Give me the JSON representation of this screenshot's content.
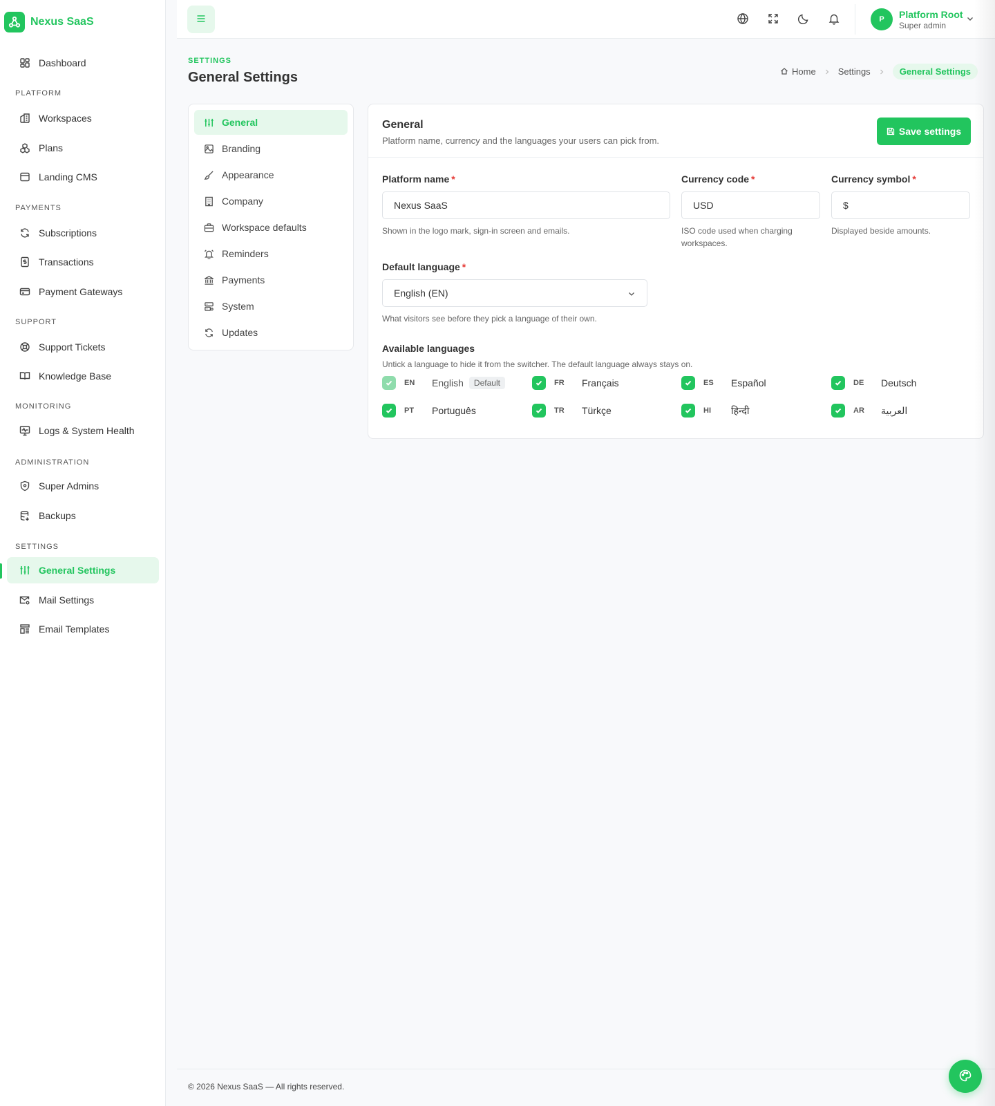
{
  "brand": {
    "name": "Nexus SaaS"
  },
  "sidebar": {
    "dashboard": "Dashboard",
    "sections": {
      "platform": "PLATFORM",
      "payments": "PAYMENTS",
      "support": "SUPPORT",
      "monitoring": "MONITORING",
      "administration": "ADMINISTRATION",
      "settings": "SETTINGS"
    },
    "items": {
      "workspaces": "Workspaces",
      "plans": "Plans",
      "landing_cms": "Landing CMS",
      "subscriptions": "Subscriptions",
      "transactions": "Transactions",
      "payment_gateways": "Payment Gateways",
      "support_tickets": "Support Tickets",
      "knowledge_base": "Knowledge Base",
      "logs_system_health": "Logs & System Health",
      "super_admins": "Super Admins",
      "backups": "Backups",
      "general_settings": "General Settings",
      "mail_settings": "Mail Settings",
      "email_templates": "Email Templates"
    }
  },
  "topbar": {
    "user_initial": "P",
    "user_name": "Platform Root",
    "user_role": "Super admin"
  },
  "page": {
    "eyebrow": "SETTINGS",
    "title": "General Settings",
    "breadcrumb": {
      "home": "Home",
      "settings": "Settings",
      "current": "General Settings"
    }
  },
  "settings_nav": {
    "general": "General",
    "branding": "Branding",
    "appearance": "Appearance",
    "company": "Company",
    "workspace_defaults": "Workspace defaults",
    "reminders": "Reminders",
    "payments": "Payments",
    "system": "System",
    "updates": "Updates"
  },
  "card": {
    "title": "General",
    "subtitle": "Platform name, currency and the languages your users can pick from.",
    "save_label": "Save settings"
  },
  "form": {
    "platform_name": {
      "label": "Platform name",
      "value": "Nexus SaaS",
      "hint": "Shown in the logo mark, sign-in screen and emails."
    },
    "currency_code": {
      "label": "Currency code",
      "value": "USD",
      "hint": "ISO code used when charging workspaces."
    },
    "currency_symbol": {
      "label": "Currency symbol",
      "value": "$",
      "hint": "Displayed beside amounts."
    },
    "default_language": {
      "label": "Default language",
      "value": "English (EN)",
      "hint": "What visitors see before they pick a language of their own."
    },
    "required_mark": "*",
    "available_languages": {
      "label": "Available languages",
      "hint": "Untick a language to hide it from the switcher. The default language always stays on.",
      "default_badge": "Default",
      "languages": [
        {
          "code": "EN",
          "name": "English",
          "checked": true,
          "is_default": true
        },
        {
          "code": "FR",
          "name": "Français",
          "checked": true
        },
        {
          "code": "ES",
          "name": "Español",
          "checked": true
        },
        {
          "code": "DE",
          "name": "Deutsch",
          "checked": true
        },
        {
          "code": "PT",
          "name": "Português",
          "checked": true
        },
        {
          "code": "TR",
          "name": "Türkçe",
          "checked": true
        },
        {
          "code": "HI",
          "name": "हिन्दी",
          "checked": true
        },
        {
          "code": "AR",
          "name": "العربية",
          "checked": true
        }
      ]
    }
  },
  "footer": {
    "text": "© 2026 Nexus SaaS — All rights reserved."
  },
  "colors": {
    "accent": "#22c55e",
    "accent_light": "#e6f8ec",
    "required": "#e53935"
  }
}
